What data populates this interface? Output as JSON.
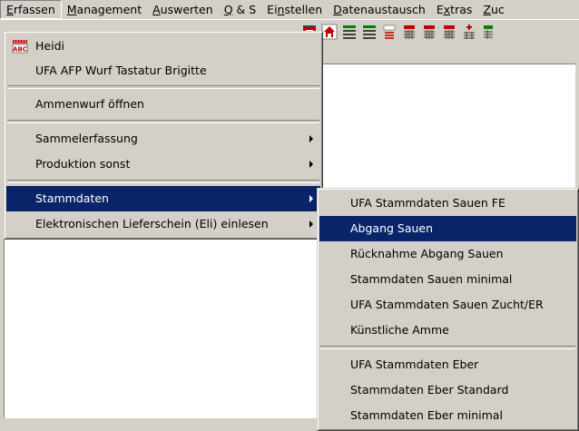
{
  "menubar": {
    "items": [
      {
        "mnemonic": "E",
        "rest": "rfassen"
      },
      {
        "mnemonic": "M",
        "rest": "anagement"
      },
      {
        "mnemonic": "A",
        "rest": "uswerten"
      },
      {
        "mnemonic": "Q",
        "rest": " & S"
      },
      {
        "pre": "Ei",
        "mnemonic": "n",
        "rest": "stellen"
      },
      {
        "mnemonic": "D",
        "rest": "atenaustausch"
      },
      {
        "pre": "E",
        "mnemonic": "x",
        "rest": "tras"
      },
      {
        "mnemonic": "Z",
        "rest": "uc"
      }
    ]
  },
  "menu_erfassen": {
    "items": [
      {
        "label": "Heidi",
        "icon": "abc-pig-icon"
      },
      {
        "label": "UFA AFP Wurf Tastatur Brigitte"
      },
      {
        "label": "Ammenwurf öffnen"
      },
      {
        "label": "Sammelerfassung"
      },
      {
        "label": "Produktion sonst"
      },
      {
        "label": "Stammdaten"
      },
      {
        "label": "Elektronischen Lieferschein (Eli) einlesen"
      }
    ]
  },
  "menu_stammdaten": {
    "items": [
      {
        "label": "UFA Stammdaten Sauen FE"
      },
      {
        "label": "Abgang Sauen"
      },
      {
        "label": "Rücknahme Abgang Sauen"
      },
      {
        "label": "Stammdaten Sauen minimal"
      },
      {
        "label": "UFA Stammdaten Sauen Zucht/ER"
      },
      {
        "label": "Künstliche Amme"
      },
      {
        "label": "UFA Stammdaten Eber"
      },
      {
        "label": "Stammdaten Eber Standard"
      },
      {
        "label": "Stammdaten Eber minimal"
      }
    ]
  },
  "colors": {
    "face": "#d4d0c8",
    "highlight": "#0a246a",
    "workspace": "#ffffff"
  }
}
